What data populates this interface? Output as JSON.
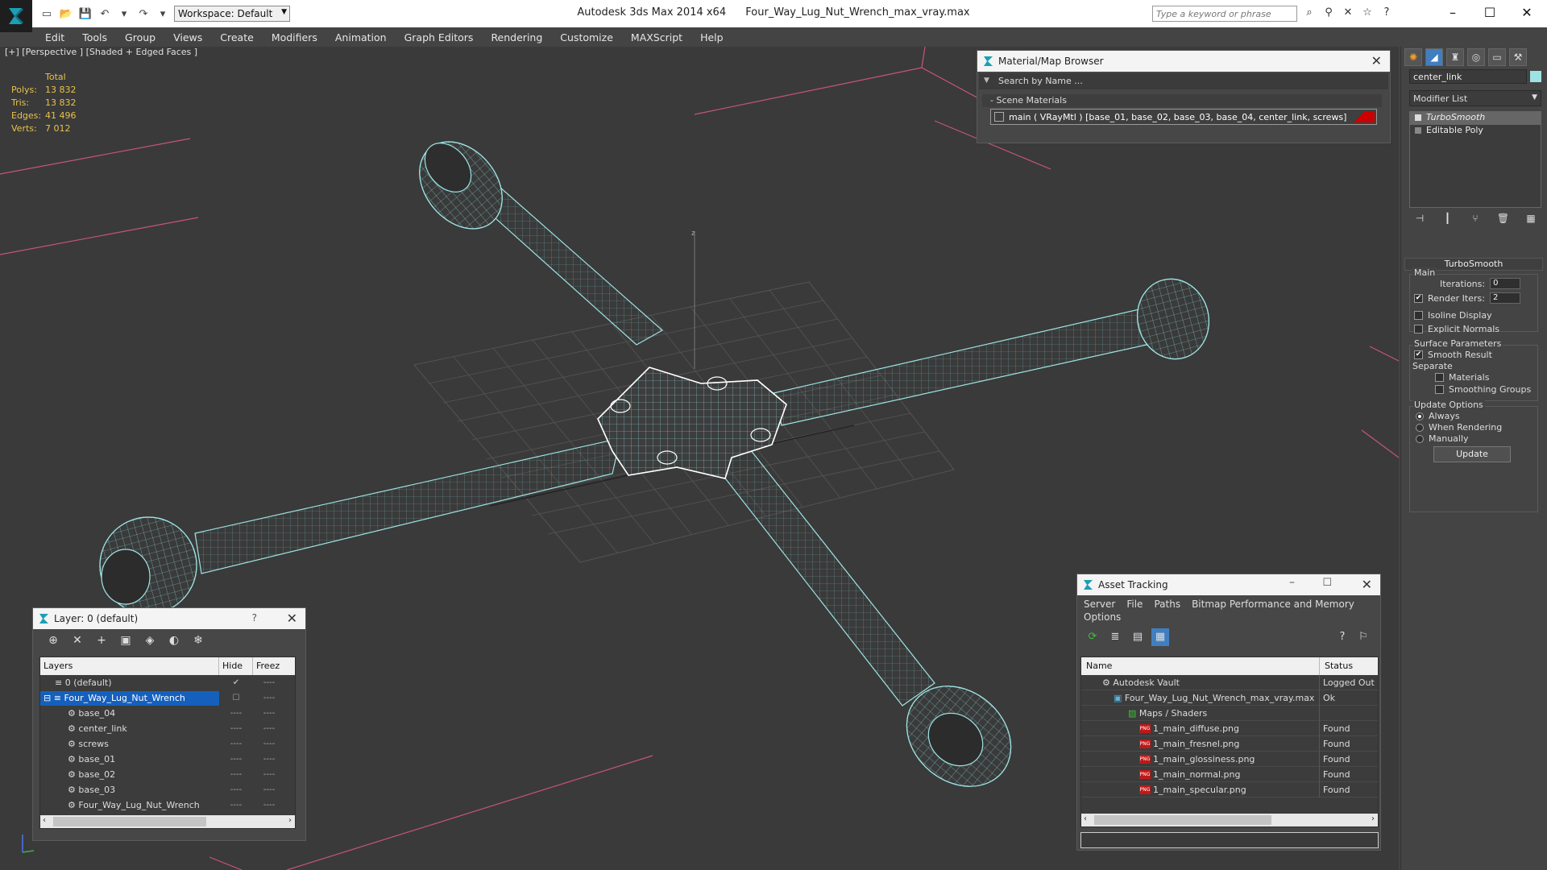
{
  "titlebar": {
    "app_title": "Autodesk 3ds Max  2014 x64",
    "file_title": "Four_Way_Lug_Nut_Wrench_max_vray.max",
    "workspace": "Workspace: Default",
    "search_placeholder": "Type a keyword or phrase"
  },
  "menu": [
    "Edit",
    "Tools",
    "Group",
    "Views",
    "Create",
    "Modifiers",
    "Animation",
    "Graph Editors",
    "Rendering",
    "Customize",
    "MAXScript",
    "Help"
  ],
  "viewport": {
    "label": "[+] [Perspective ] [Shaded + Edged Faces ]",
    "stats": {
      "header": "Total",
      "polys_label": "Polys:",
      "polys": "13 832",
      "tris_label": "Tris:",
      "tris": "13 832",
      "edges_label": "Edges:",
      "edges": "41 496",
      "verts_label": "Verts:",
      "verts": "7 012"
    },
    "axis_label": "z",
    "wire_color": "#9ee3e3"
  },
  "material_browser": {
    "title": "Material/Map Browser",
    "search_placeholder": "Search by Name ...",
    "section": "Scene Materials",
    "material": "main  ( VRayMtl )  [base_01, base_02, base_03, base_04, center_link, screws]"
  },
  "layer_panel": {
    "title": "Layer: 0 (default)",
    "help": "?",
    "columns": [
      "Layers",
      "Hide",
      "Freez"
    ],
    "rows": [
      {
        "name": "0 (default)",
        "indent": 1
      },
      {
        "name": "Four_Way_Lug_Nut_Wrench",
        "indent": 1
      },
      {
        "name": "base_04",
        "indent": 2
      },
      {
        "name": "center_link",
        "indent": 2
      },
      {
        "name": "screws",
        "indent": 2
      },
      {
        "name": "base_01",
        "indent": 2
      },
      {
        "name": "base_02",
        "indent": 2
      },
      {
        "name": "base_03",
        "indent": 2
      },
      {
        "name": "Four_Way_Lug_Nut_Wrench",
        "indent": 2
      }
    ]
  },
  "asset_tracking": {
    "title": "Asset Tracking",
    "menu": [
      "Server",
      "File",
      "Paths",
      "Bitmap Performance and Memory",
      "Options"
    ],
    "columns": [
      "Name",
      "Status"
    ],
    "rows": [
      {
        "name": "Autodesk Vault",
        "status": "Logged Out ...",
        "indent": 1,
        "icon": "vault"
      },
      {
        "name": "Four_Way_Lug_Nut_Wrench_max_vray.max",
        "status": "Ok",
        "indent": 2,
        "icon": "max"
      },
      {
        "name": "Maps / Shaders",
        "status": "",
        "indent": 3,
        "icon": "folder"
      },
      {
        "name": "1_main_diffuse.png",
        "status": "Found",
        "indent": 4,
        "icon": "png"
      },
      {
        "name": "1_main_fresnel.png",
        "status": "Found",
        "indent": 4,
        "icon": "png"
      },
      {
        "name": "1_main_glossiness.png",
        "status": "Found",
        "indent": 4,
        "icon": "png"
      },
      {
        "name": "1_main_normal.png",
        "status": "Found",
        "indent": 4,
        "icon": "png"
      },
      {
        "name": "1_main_specular.png",
        "status": "Found",
        "indent": 4,
        "icon": "png"
      }
    ]
  },
  "command_panel": {
    "object_name": "center_link",
    "modifier_list": "Modifier List",
    "stack": [
      "TurboSmooth",
      "Editable Poly"
    ],
    "turbosmooth": {
      "title": "TurboSmooth",
      "main_label": "Main",
      "iterations_label": "Iterations:",
      "iterations": "0",
      "render_iters_label": "Render Iters:",
      "render_iters": "2",
      "isoline": "Isoline Display",
      "explicit_normals": "Explicit Normals",
      "surface_params": "Surface Parameters",
      "smooth_result": "Smooth Result",
      "separate": "Separate",
      "materials": "Materials",
      "smoothing_groups": "Smoothing Groups",
      "update_options": "Update Options",
      "always": "Always",
      "when_rendering": "When Rendering",
      "manually": "Manually",
      "update_button": "Update"
    }
  }
}
